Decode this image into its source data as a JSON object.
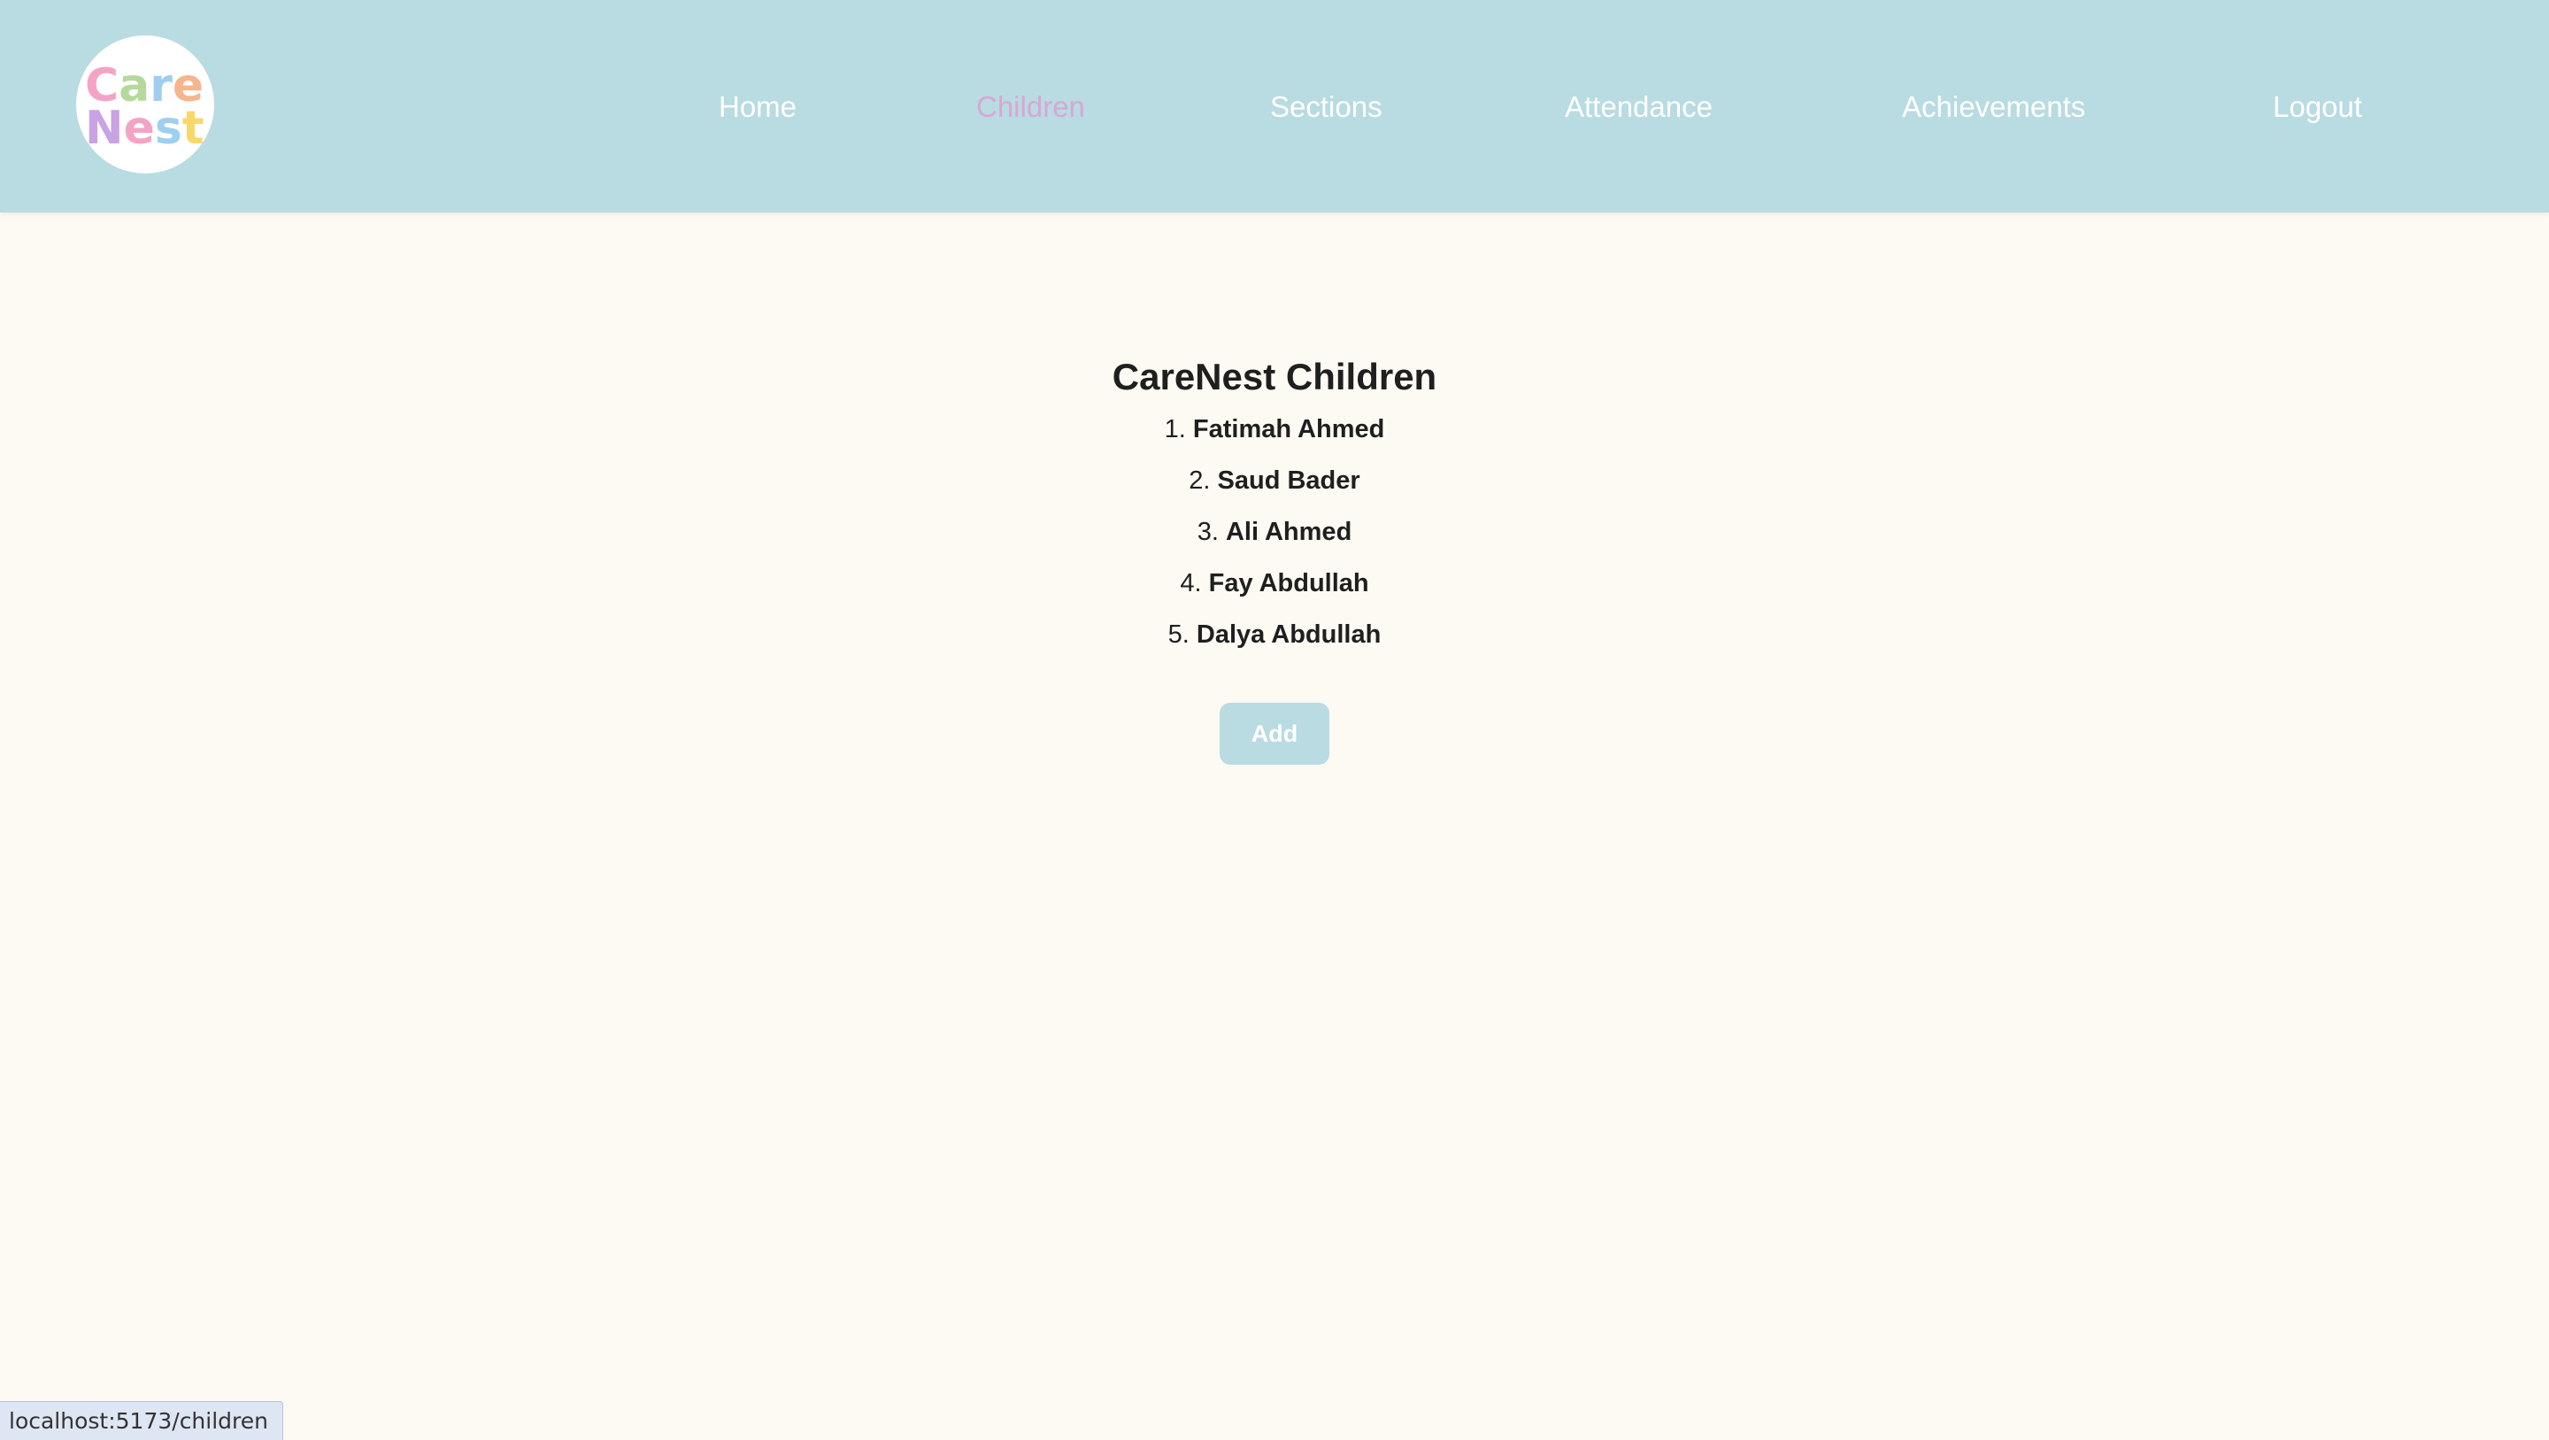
{
  "brand": {
    "logo_line1": "Care",
    "logo_line2": "Nest",
    "colors": {
      "header_bg": "#b9dbe2",
      "page_bg": "#fdfaf3",
      "nav_text": "#ffffff",
      "nav_active": "#d9a6d6",
      "logo_c": "#f3a4c4",
      "logo_a": "#b5d99c",
      "logo_r": "#9fcff0",
      "logo_e": "#f6b58c",
      "logo_n": "#c9a2e6",
      "logo_e2": "#f3a4c4",
      "logo_s": "#9fcff0",
      "logo_t": "#f8d86a"
    }
  },
  "nav": {
    "items": [
      {
        "label": "Home",
        "active": false
      },
      {
        "label": "Children",
        "active": true
      },
      {
        "label": "Sections",
        "active": false
      },
      {
        "label": "Attendance",
        "active": false
      },
      {
        "label": "Achievements",
        "active": false
      },
      {
        "label": "Logout",
        "active": false
      }
    ]
  },
  "main": {
    "title": "CareNest Children",
    "children": [
      {
        "number": "1.",
        "name": "Fatimah Ahmed"
      },
      {
        "number": "2.",
        "name": "Saud Bader"
      },
      {
        "number": "3.",
        "name": "Ali Ahmed"
      },
      {
        "number": "4.",
        "name": "Fay Abdullah"
      },
      {
        "number": "5.",
        "name": "Dalya Abdullah"
      }
    ],
    "add_label": "Add"
  },
  "status_bar": {
    "url": "localhost:5173/children"
  }
}
